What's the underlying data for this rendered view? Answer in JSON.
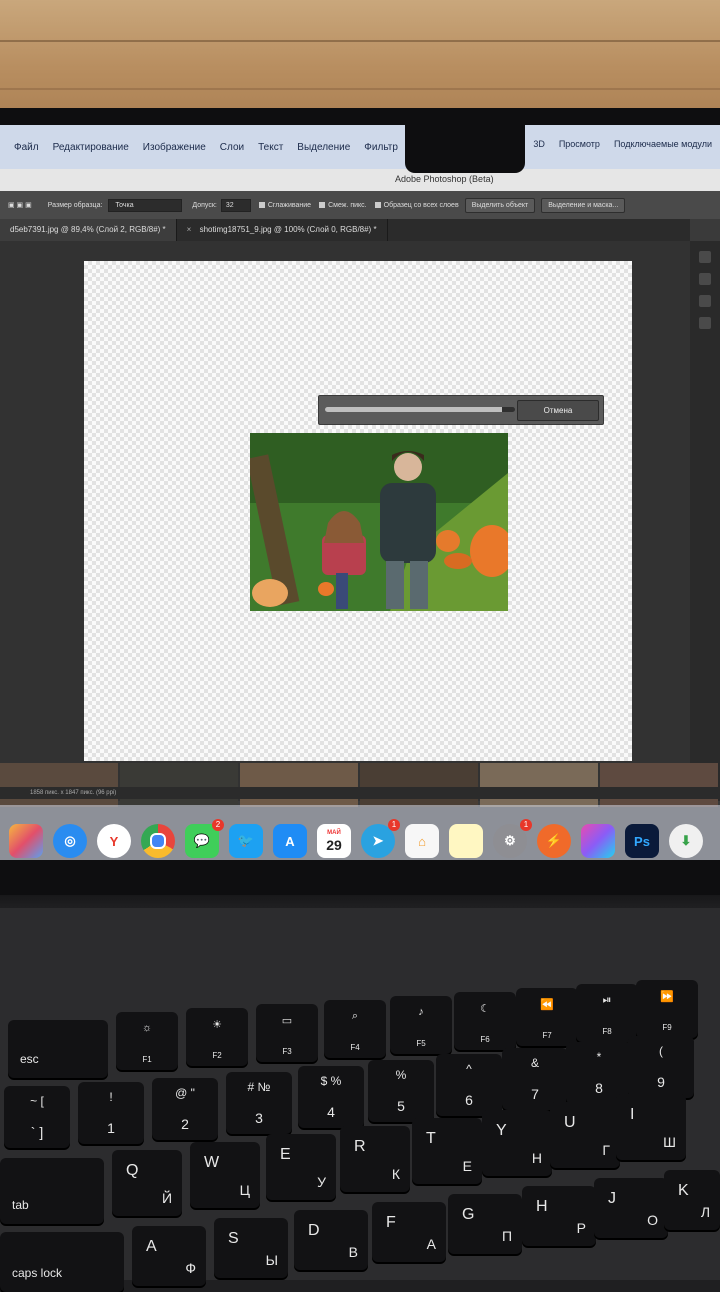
{
  "menubar": {
    "items": [
      "Файл",
      "Редактирование",
      "Изображение",
      "Слои",
      "Текст",
      "Выделение",
      "Фильтр"
    ],
    "right_items": [
      "3D",
      "Просмотр",
      "Подключаемые модули"
    ]
  },
  "ps_window": {
    "title": "Adobe Photoshop (Beta)"
  },
  "options": {
    "sample_size_label": "Размер образца:",
    "sample_size_value": "Точка",
    "tolerance_label": "Допуск:",
    "tolerance_value": "32",
    "antialias_label": "Сглаживание",
    "contiguous_label": "Смеж. пикс.",
    "all_layers_label": "Образец со всех слоев",
    "select_subject_label": "Выделить объект",
    "select_mask_label": "Выделение и маска..."
  },
  "tabs": [
    {
      "label": "d5eb7391.jpg @ 89,4% (Слой 2, RGB/8#) *",
      "active": true
    },
    {
      "label": "shotimg18751_9.jpg @ 100% (Слой 0, RGB/8#) *",
      "active": false
    }
  ],
  "progress": {
    "cancel_label": "Отмена",
    "percent": 93
  },
  "status": {
    "text": "1858 пикс. x 1847 пикс. (96 ppi)"
  },
  "dock": {
    "apps": [
      {
        "name": "Launchpad",
        "icon": "launchpad-icon",
        "badge": ""
      },
      {
        "name": "Safari",
        "icon": "safari-icon",
        "badge": ""
      },
      {
        "name": "Yandex",
        "icon": "yandex-icon",
        "glyph": "Y",
        "badge": ""
      },
      {
        "name": "Chrome",
        "icon": "chrome-icon",
        "badge": ""
      },
      {
        "name": "Messages",
        "icon": "messages-icon",
        "badge": "2"
      },
      {
        "name": "Twitter",
        "icon": "twitter-icon",
        "badge": ""
      },
      {
        "name": "App Store",
        "icon": "app-store-icon",
        "badge": ""
      },
      {
        "name": "Calendar",
        "icon": "calendar-icon",
        "month": "МАЙ",
        "day": "29",
        "badge": ""
      },
      {
        "name": "Telegram",
        "icon": "telegram-icon",
        "badge": "1"
      },
      {
        "name": "Home",
        "icon": "home-icon",
        "badge": ""
      },
      {
        "name": "Notes",
        "icon": "notes-icon",
        "badge": ""
      },
      {
        "name": "System Settings",
        "icon": "settings-icon",
        "badge": "1"
      },
      {
        "name": "Spark",
        "icon": "spark-icon",
        "badge": ""
      },
      {
        "name": "Final Cut Pro",
        "icon": "final-cut-icon",
        "badge": ""
      },
      {
        "name": "Photoshop",
        "icon": "photoshop-icon",
        "glyph": "Ps",
        "badge": ""
      },
      {
        "name": "Downloads",
        "icon": "downloads-icon",
        "badge": ""
      }
    ]
  },
  "keyboard": {
    "esc": "esc",
    "tab": "tab",
    "caps": "caps lock",
    "f1": "F1",
    "f2": "F2",
    "f3": "F3",
    "f4": "F4",
    "f5": "F5",
    "f6": "F6",
    "f7": "F7",
    "f8": "F8",
    "f9": "F9",
    "row1": [
      {
        "top": "~ [",
        "bot": "` ]"
      },
      {
        "top": "!",
        "bot": "1"
      },
      {
        "top": "@ \"",
        "bot": "2"
      },
      {
        "top": "# №",
        "bot": "3"
      },
      {
        "top": "$ %",
        "bot": "4"
      },
      {
        "top": "%",
        "bot": "5"
      },
      {
        "top": "^",
        "bot": "6"
      },
      {
        "top": "&",
        "bot": "7"
      },
      {
        "top": "*",
        "bot": "8"
      },
      {
        "top": "(",
        "bot": "9"
      }
    ],
    "row2": [
      {
        "en": "Q",
        "ru": "Й"
      },
      {
        "en": "W",
        "ru": "Ц"
      },
      {
        "en": "E",
        "ru": "У"
      },
      {
        "en": "R",
        "ru": "К"
      },
      {
        "en": "T",
        "ru": "Е"
      },
      {
        "en": "Y",
        "ru": "Н"
      },
      {
        "en": "U",
        "ru": "Г"
      },
      {
        "en": "I",
        "ru": "Ш"
      }
    ],
    "row3": [
      {
        "en": "A",
        "ru": "Ф"
      },
      {
        "en": "S",
        "ru": "Ы"
      },
      {
        "en": "D",
        "ru": "В"
      },
      {
        "en": "F",
        "ru": "А"
      },
      {
        "en": "G",
        "ru": "П"
      },
      {
        "en": "H",
        "ru": "Р"
      },
      {
        "en": "J",
        "ru": "О"
      },
      {
        "en": "K",
        "ru": "Л"
      }
    ]
  }
}
